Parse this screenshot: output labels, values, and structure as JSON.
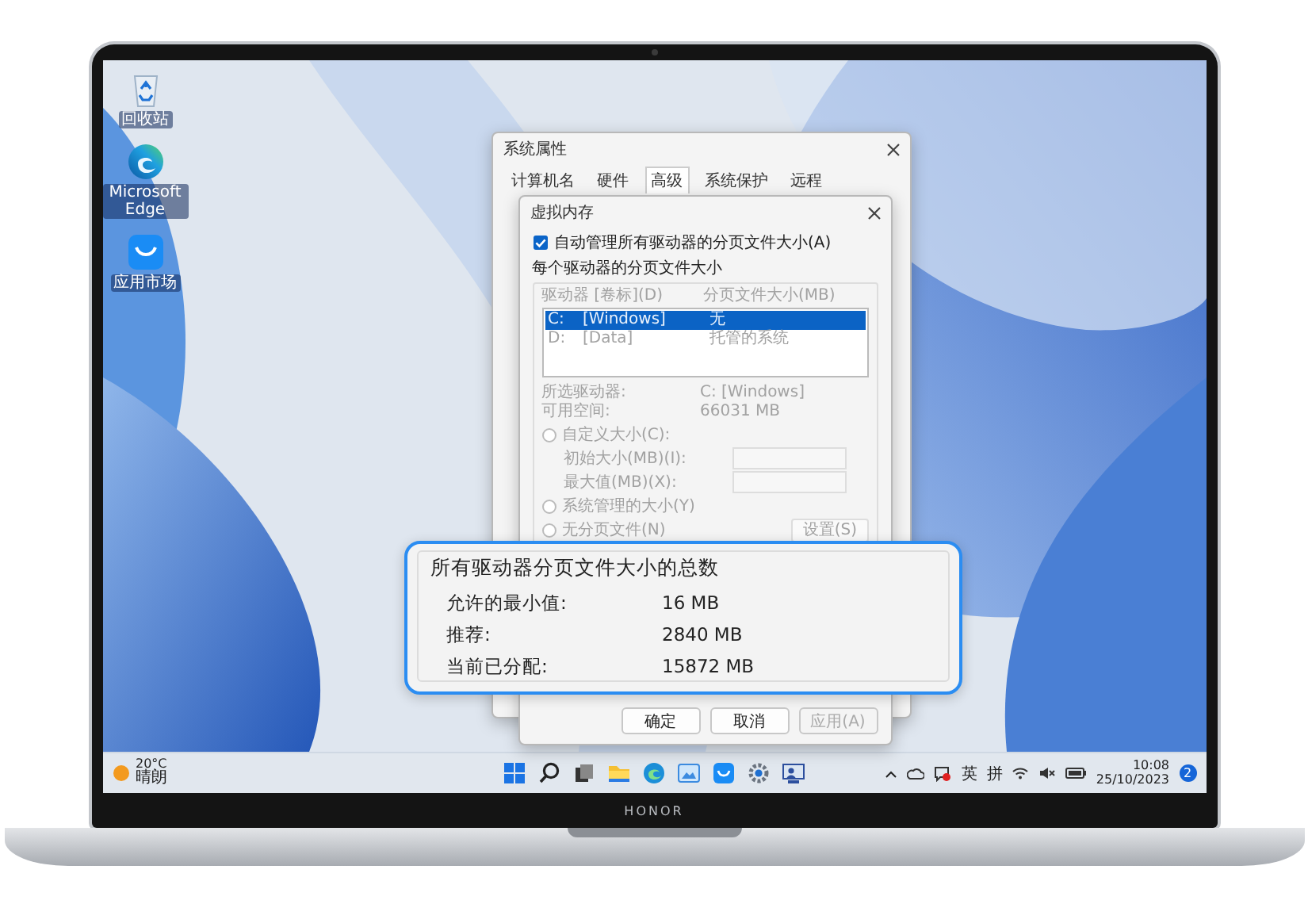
{
  "desktop_icons": [
    {
      "label": "回收站"
    },
    {
      "label": "Microsoft Edge"
    },
    {
      "label": "应用市场"
    }
  ],
  "system_properties": {
    "title": "系统属性",
    "tabs": [
      {
        "label": "计算机名",
        "selected": false
      },
      {
        "label": "硬件",
        "selected": false
      },
      {
        "label": "高级",
        "selected": true
      },
      {
        "label": "系统保护",
        "selected": false
      },
      {
        "label": "远程",
        "selected": false
      }
    ]
  },
  "virtual_memory": {
    "title": "虚拟内存",
    "auto_manage": {
      "label": "自动管理所有驱动器的分页文件大小(A)",
      "checked": true
    },
    "group_label": "每个驱动器的分页文件大小",
    "disabled": true,
    "columns": [
      "驱动器 [卷标](D)",
      "分页文件大小(MB)"
    ],
    "drives": [
      {
        "drive": "C:",
        "volume": "[Windows]",
        "size": "无",
        "selected": true
      },
      {
        "drive": "D:",
        "volume": "[Data]",
        "size": "托管的系统",
        "selected": false
      }
    ],
    "selected_drive": {
      "label": "所选驱动器:",
      "value": "C:  [Windows]"
    },
    "free_space": {
      "label": "可用空间:",
      "value": "66031 MB"
    },
    "options": [
      {
        "kind": "radio",
        "label": "自定义大小(C):",
        "selected": false
      },
      {
        "kind": "field",
        "label": "初始大小(MB)(I):"
      },
      {
        "kind": "field",
        "label": "最大值(MB)(X):"
      },
      {
        "kind": "radio",
        "label": "系统管理的大小(Y)",
        "selected": false
      },
      {
        "kind": "radio",
        "label": "无分页文件(N)",
        "selected": false,
        "button": "设置(S)"
      }
    ],
    "buttons": [
      {
        "label": "确定",
        "disabled": false
      },
      {
        "label": "取消",
        "disabled": false
      },
      {
        "label": "应用(A)",
        "disabled": true
      }
    ]
  },
  "callout": {
    "title": "所有驱动器分页文件大小的总数",
    "rows": [
      {
        "label": "允许的最小值:",
        "value": "16 MB"
      },
      {
        "label": "推荐:",
        "value": "2840 MB"
      },
      {
        "label": "当前已分配:",
        "value": "15872 MB"
      }
    ]
  },
  "taskbar": {
    "weather": {
      "temperature": "20°C",
      "condition": "晴朗"
    },
    "ime": [
      "英",
      "拼"
    ],
    "time": "10:08",
    "date": "25/10/2023",
    "notifications": "2"
  },
  "brand": "HONOR"
}
